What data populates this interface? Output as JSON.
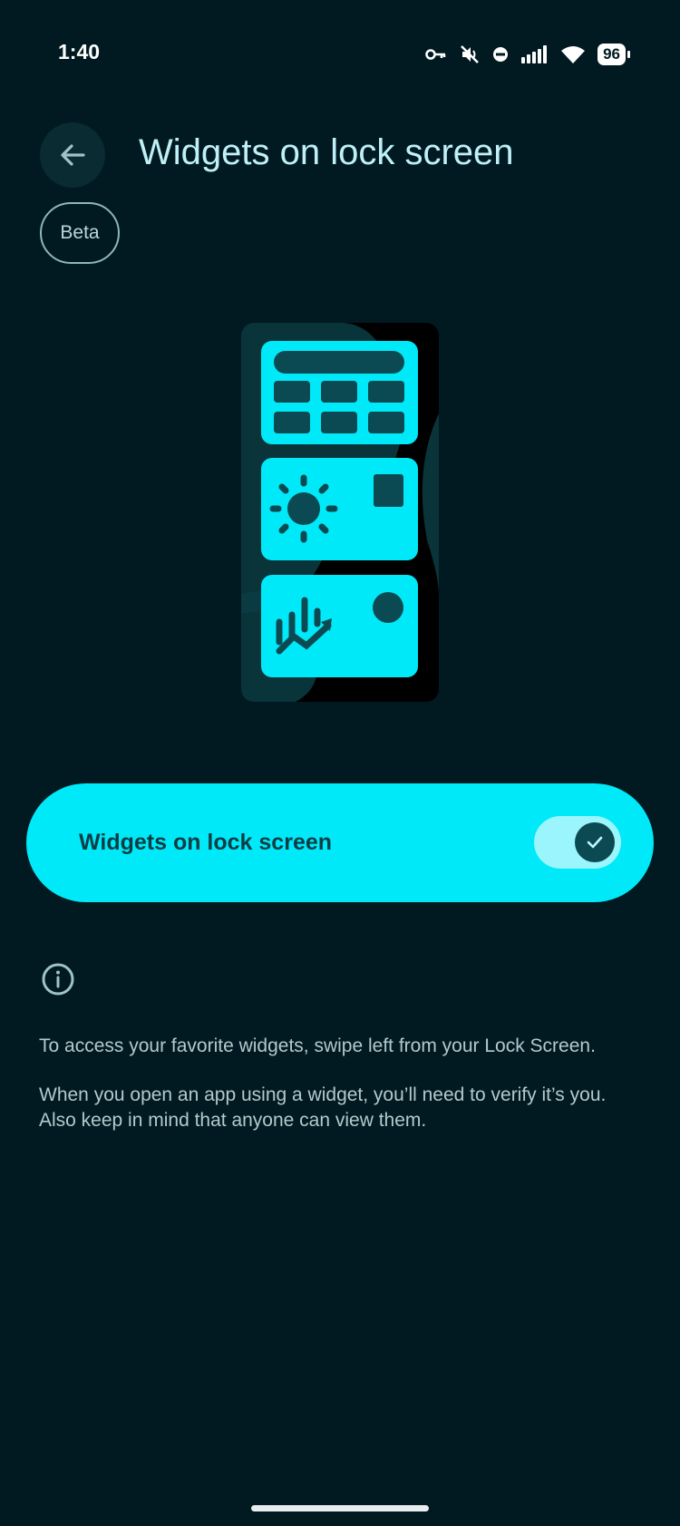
{
  "status_bar": {
    "time": "1:40",
    "battery": "96",
    "icons": [
      "vpn-key-icon",
      "mute-icon",
      "do-not-disturb-icon",
      "signal-icon",
      "wifi-icon",
      "battery-icon"
    ]
  },
  "header": {
    "back_icon": "arrow-left-icon",
    "title": "Widgets on lock screen",
    "badge": "Beta"
  },
  "illustration": {
    "widgets": [
      "calendar-widget",
      "weather-widget",
      "stocks-widget"
    ]
  },
  "toggle": {
    "label": "Widgets on lock screen",
    "checked": true
  },
  "info": {
    "icon": "info-icon",
    "paragraph_1": "To access your favorite widgets, swipe left from your Lock Screen.",
    "paragraph_2": "When you open an app using a widget, you’ll need to verify it’s you. Also keep in mind that anyone can view them."
  },
  "colors": {
    "background": "#011a21",
    "accent": "#00e9f9",
    "accent_dark": "#0b4a52",
    "title": "#bff0f7"
  }
}
